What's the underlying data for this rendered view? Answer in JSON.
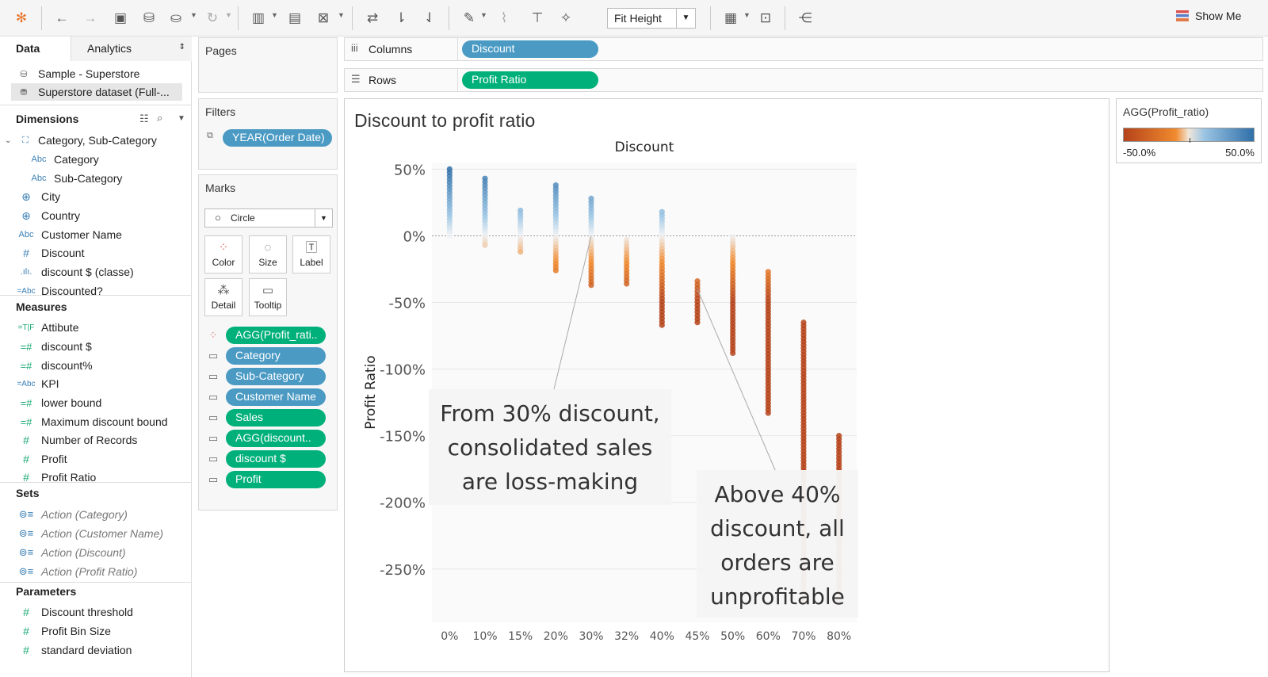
{
  "toolbar": {
    "fit_label": "Fit Height",
    "show_me": "Show Me"
  },
  "data_tabs": {
    "data": "Data",
    "analytics": "Analytics"
  },
  "datasources": [
    "Sample - Superstore",
    "Superstore dataset (Full-..."
  ],
  "dimensions": {
    "title": "Dimensions",
    "items": [
      "Category, Sub-Category",
      "Category",
      "Sub-Category",
      "City",
      "Country",
      "Customer Name",
      "Discount",
      "discount $ (classe)",
      "Discounted?"
    ]
  },
  "measures": {
    "title": "Measures",
    "items": [
      "Attibute",
      "discount $",
      "discount%",
      "KPI",
      "lower bound",
      "Maximum discount bound",
      "Number of Records",
      "Profit",
      "Profit Ratio"
    ]
  },
  "sets": {
    "title": "Sets",
    "items": [
      "Action (Category)",
      "Action (Customer Name)",
      "Action (Discount)",
      "Action (Profit Ratio)"
    ]
  },
  "parameters": {
    "title": "Parameters",
    "items": [
      "Discount threshold",
      "Profit Bin Size",
      "standard deviation"
    ]
  },
  "shelves": {
    "pages": "Pages",
    "columns": "Columns",
    "columns_pill": "Discount",
    "rows": "Rows",
    "rows_pill": "Profit Ratio",
    "filters": "Filters",
    "filter_pill": "YEAR(Order Date)"
  },
  "marks": {
    "title": "Marks",
    "type": "Circle",
    "buttons": [
      "Color",
      "Size",
      "Label",
      "Detail",
      "Tooltip"
    ],
    "pills": [
      "AGG(Profit_rati..",
      "Category",
      "Sub-Category",
      "Customer Name",
      "Sales",
      "AGG(discount..",
      "discount $",
      "Profit"
    ]
  },
  "legend": {
    "title": "AGG(Profit_ratio)",
    "min": "-50.0%",
    "max": "50.0%"
  },
  "view_title": "Discount to profit ratio",
  "annotations": [
    "From 30% discount, consolidated sales are loss-making",
    "Above 40% discount, all orders are unprofitable"
  ],
  "chart_data": {
    "type": "scatter",
    "title": "Discount",
    "xlabel": "Discount",
    "ylabel": "Profit Ratio",
    "categories": [
      "0%",
      "10%",
      "15%",
      "20%",
      "30%",
      "32%",
      "40%",
      "45%",
      "50%",
      "60%",
      "70%",
      "80%"
    ],
    "y_ticks": [
      "50%",
      "0%",
      "-50%",
      "-100%",
      "-150%",
      "-200%",
      "-250%"
    ],
    "ylim": [
      -290,
      55
    ],
    "color_scale": {
      "min": -50,
      "max": 50,
      "low": "#b5431a",
      "mid": "#eef1f4",
      "high": "#2f6fa8"
    },
    "ranges": [
      {
        "x": "0%",
        "min": 0,
        "max": 50
      },
      {
        "x": "10%",
        "min": -7,
        "max": 43
      },
      {
        "x": "15%",
        "min": -12,
        "max": 19
      },
      {
        "x": "20%",
        "min": -26,
        "max": 38
      },
      {
        "x": "30%",
        "min": -37,
        "max": 28
      },
      {
        "x": "32%",
        "min": -36,
        "max": -3
      },
      {
        "x": "40%",
        "min": -67,
        "max": 18
      },
      {
        "x": "45%",
        "min": -65,
        "max": -34
      },
      {
        "x": "50%",
        "min": -88,
        "max": -1
      },
      {
        "x": "60%",
        "min": -133,
        "max": -27
      },
      {
        "x": "70%",
        "min": -275,
        "max": -65
      },
      {
        "x": "80%",
        "min": -275,
        "max": -150
      }
    ]
  }
}
